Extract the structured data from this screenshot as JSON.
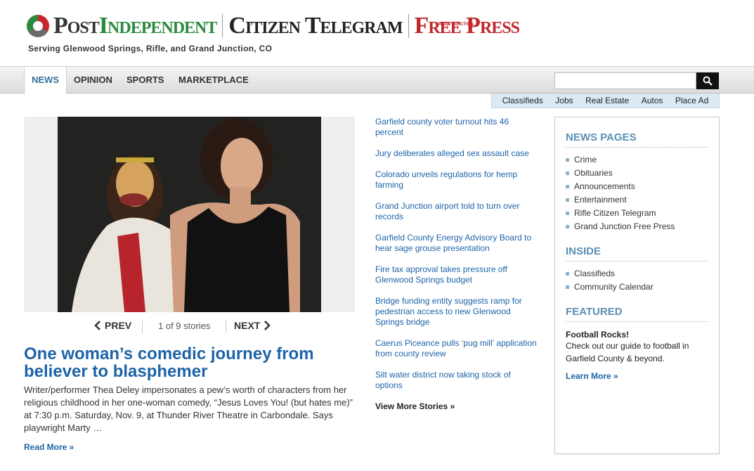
{
  "masthead": {
    "post_independent_1": "Post",
    "post_independent_2": "Independent",
    "citizen_telegram": "Citizen Telegram",
    "free_press_small": "GRAND JUNCTION",
    "free_press": "Free Press",
    "tagline": "Serving Glenwood Springs, Rifle, and Grand Junction, CO"
  },
  "nav": {
    "items": [
      "NEWS",
      "OPINION",
      "SPORTS",
      "MARKETPLACE"
    ],
    "active": "NEWS"
  },
  "search": {
    "placeholder": ""
  },
  "utility": [
    "Classifieds",
    "Jobs",
    "Real Estate",
    "Autos",
    "Place Ad"
  ],
  "slideshow": {
    "prev": "PREV",
    "counter": "1 of 9 stories",
    "next": "NEXT",
    "headline": "One woman’s comedic journey from believer to blasphemer",
    "summary": "Writer/performer Thea Deley impersonates a pew’s worth of characters from her religious childhood in her one-woman comedy, “Jesus Loves You! (but hates me)” at 7:30 p.m. Saturday, Nov. 9, at Thunder River Theatre in Carbondale. Says playwright Marty …",
    "read_more": "Read More »"
  },
  "stories": [
    "Garfield county voter turnout hits 46 percent",
    "Jury deliberates alleged sex assault case",
    "Colorado unveils regulations for hemp farming",
    "Grand Junction airport told to turn over records",
    "Garfield County Energy Advisory Board to hear sage grouse presentation",
    "Fire tax approval takes pressure off Glenwood Springs budget",
    "Bridge funding entity suggests ramp for pedestrian access to new Glenwood Springs bridge",
    "Caerus Piceance pulls ‘pug mill’ application from county review",
    "Silt water district now taking stock of options"
  ],
  "view_more": "View More Stories »",
  "sidebar": {
    "news_pages": {
      "title": "NEWS PAGES",
      "items": [
        "Crime",
        "Obituaries",
        "Announcements",
        "Entertainment",
        "Rifle Citizen Telegram",
        "Grand Junction Free Press"
      ]
    },
    "inside": {
      "title": "INSIDE",
      "items": [
        "Classifieds",
        "Community Calendar"
      ]
    },
    "featured": {
      "title": "FEATURED",
      "item_title": "Football Rocks!",
      "item_text": "Check out our guide to football in Garfield County & beyond.",
      "learn_more": "Learn More »"
    }
  },
  "colors": {
    "link": "#1d64a8",
    "section": "#5a8fb4",
    "utility_bg": "#dbe9f4",
    "fp_red": "#c0262c",
    "pi_green": "#2c8a3e"
  }
}
